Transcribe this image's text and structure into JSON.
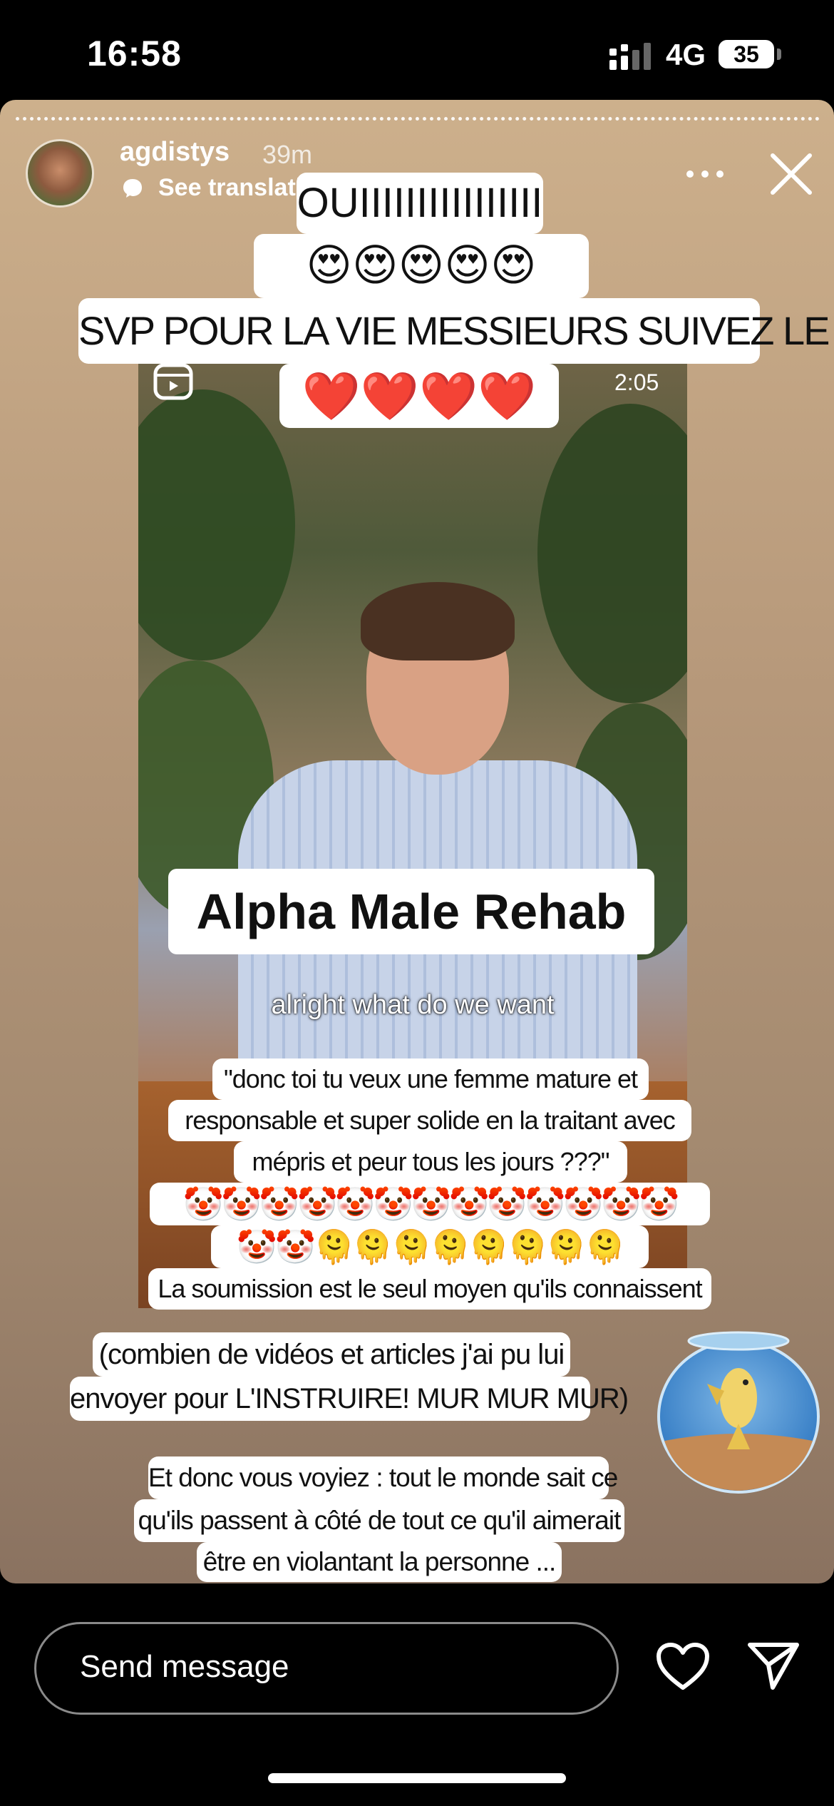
{
  "status_bar": {
    "time": "16:58",
    "network": "4G",
    "battery": "35"
  },
  "story": {
    "username": "agdistys",
    "time_ago": "39m",
    "see_translation": "See translation",
    "stickers": {
      "oui": "OUIIIIIIIIIIIIIIII",
      "heart_eyes": "😍😍😍😍😍",
      "svp": "SVP POUR LA VIE MESSIEURS SUIVEZ LE",
      "hearts": "❤️❤️❤️❤️",
      "quote_line1": "\"donc toi tu veux une femme mature et",
      "quote_line2": "responsable et super solide en la traitant avec",
      "quote_line3": "mépris et peur tous les jours ???\"",
      "clowns_line": "🤡🤡🤡🤡🤡🤡🤡🤡🤡🤡🤡🤡🤡",
      "melt_line": "🤡🤡🫠🫠🫠🫠🫠🫠🫠🫠",
      "soumission": "La soumission est le seul moyen qu'ils connaissent",
      "combien_line1": "(combien de vidéos et articles j'ai pu lui",
      "combien_line2": "envoyer pour L'INSTRUIRE! MUR MUR MUR)",
      "donc_line1": "Et donc vous voyiez : tout le monde sait ce",
      "donc_line2": "qu'ils passent à côté de tout ce qu'il aimerait",
      "donc_line3": "être en violantant la personne ..."
    },
    "reel": {
      "duration": "2:05",
      "title_card": "Alpha Male Rehab",
      "caption": "alright what do we want"
    }
  },
  "footer": {
    "message_placeholder": "Send message"
  },
  "icons": [
    "signal-icon",
    "battery-icon",
    "translate-icon",
    "more-icon",
    "close-icon",
    "reel-icon",
    "fishbowl-sticker",
    "heart-icon",
    "send-icon"
  ]
}
